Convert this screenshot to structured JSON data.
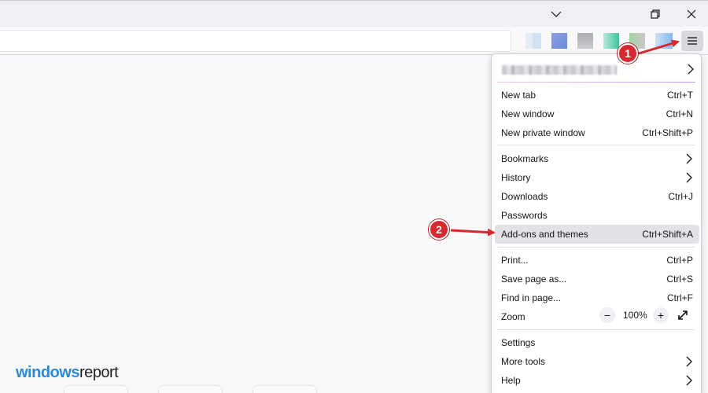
{
  "window": {
    "buttons": [
      "chevron-down",
      "restore",
      "close"
    ]
  },
  "toolbar": {
    "extensions": [
      "extension-1",
      "extension-2",
      "extension-3",
      "extension-4",
      "extension-5",
      "extension-6"
    ]
  },
  "menu": {
    "items": [
      {
        "label": "New tab",
        "shortcut": "Ctrl+T"
      },
      {
        "label": "New window",
        "shortcut": "Ctrl+N"
      },
      {
        "label": "New private window",
        "shortcut": "Ctrl+Shift+P"
      },
      {
        "label": "Bookmarks",
        "submenu": true
      },
      {
        "label": "History",
        "submenu": true
      },
      {
        "label": "Downloads",
        "shortcut": "Ctrl+J"
      },
      {
        "label": "Passwords"
      },
      {
        "label": "Add-ons and themes",
        "shortcut": "Ctrl+Shift+A",
        "highlighted": true
      },
      {
        "label": "Print...",
        "shortcut": "Ctrl+P"
      },
      {
        "label": "Save page as...",
        "shortcut": "Ctrl+S"
      },
      {
        "label": "Find in page...",
        "shortcut": "Ctrl+F"
      },
      {
        "label": "Zoom"
      },
      {
        "label": "Settings"
      },
      {
        "label": "More tools",
        "submenu": true
      },
      {
        "label": "Help",
        "submenu": true
      }
    ],
    "zoom": {
      "minus": "−",
      "value": "100%",
      "plus": "+"
    }
  },
  "annotations": {
    "marker1": "1",
    "marker2": "2",
    "color": "#d7282f"
  },
  "watermark": {
    "part1": "windows",
    "part2": "report"
  },
  "colors": {
    "highlight": "#e2e2e6",
    "menu_bg": "#ffffff",
    "page_bg": "#f9f9fb"
  }
}
